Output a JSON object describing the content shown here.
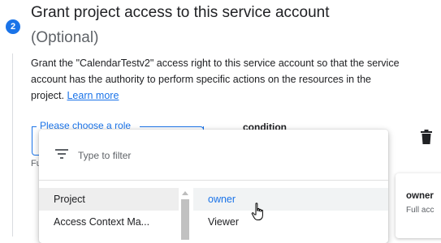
{
  "step": {
    "number": "2"
  },
  "header": {
    "title": "Grant project access to this service account",
    "subtitle": "(Optional)"
  },
  "description": {
    "line1": "Grant the \"CalendarTestv2\" access right to this service account so that the service",
    "line2": "account has the authority to perform specific actions on the resources in the",
    "line3_prefix": "project.",
    "learn_more": "Learn more"
  },
  "role_field": {
    "label": "Please choose a role",
    "helper_visible": "Fu"
  },
  "condition": {
    "label": "condition"
  },
  "dropdown": {
    "filter_placeholder": "Type to filter",
    "categories": [
      {
        "label": "Project",
        "selected": true
      },
      {
        "label": "Access Context Ma...",
        "selected": false
      }
    ],
    "roles": [
      {
        "label": "owner",
        "active": true
      },
      {
        "label": "Viewer",
        "active": false
      }
    ]
  },
  "side_card": {
    "title": "owner",
    "desc": "Full acc"
  },
  "colors": {
    "accent": "#1a73e8",
    "text": "#202124",
    "muted": "#5f6368"
  }
}
